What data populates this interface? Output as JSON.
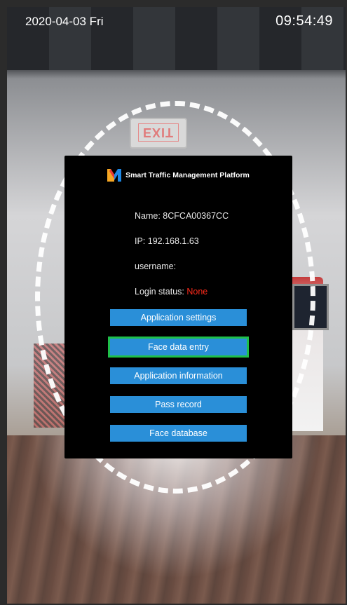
{
  "status_bar": {
    "date": "2020-04-03 Fri",
    "time": "09:54:49"
  },
  "panel": {
    "logo_icon": "m-logo-icon",
    "title": "Smart Traffic Management Platform",
    "name_label": "Name: ",
    "name_value": "8CFCA00367CC",
    "ip_label": "IP: ",
    "ip_value": "192.168.1.63",
    "username_label": "username:",
    "username_value": "",
    "login_status_label": "Login status: ",
    "login_status_value": "None",
    "login_status_color": "#ff2a1a"
  },
  "menu": {
    "items": [
      {
        "label": "Application settings",
        "focused": false
      },
      {
        "label": "Face data entry",
        "focused": true
      },
      {
        "label": "Application information",
        "focused": false
      },
      {
        "label": "Pass record",
        "focused": false
      },
      {
        "label": "Face database",
        "focused": false
      }
    ],
    "button_color": "#2a8fd8",
    "focus_color": "#1fbf4a"
  },
  "scene": {
    "exit_sign_text": "EXIT"
  }
}
